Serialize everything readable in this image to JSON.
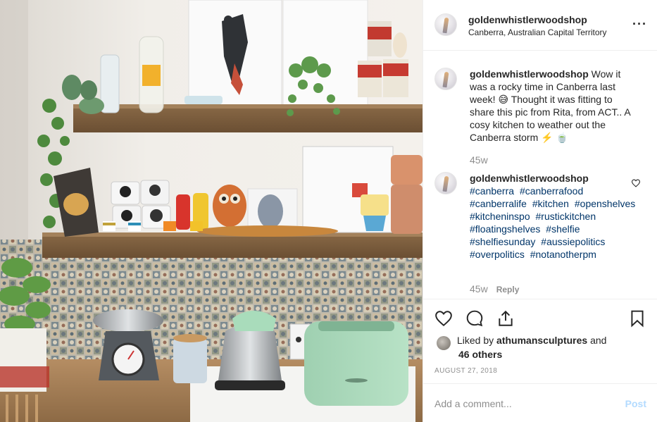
{
  "post": {
    "username": "goldenwhistlerwoodshop",
    "location": "Canberra, Australian Capital Territory",
    "more_icon": "more-horizontal-icon"
  },
  "caption": {
    "username": "goldenwhistlerwoodshop",
    "text": "Wow it was a rocky time in Canberra last week! 😅 Thought it was fitting to share this pic from Rita, from ACT.. A cosy kitchen to weather out the Canberra storm ⚡️ 🍵",
    "age": "45w"
  },
  "reply_comment": {
    "username": "goldenwhistlerwoodshop",
    "hashtags": [
      "#canberra",
      "#canberrafood",
      "#canberralife",
      "#kitchen",
      "#openshelves",
      "#kitcheninspo",
      "#rustickitchen",
      "#floatingshelves",
      "#shelfie",
      "#shelfiesunday",
      "#aussiepolitics",
      "#overpolitics",
      "#notanotherpm"
    ],
    "age": "45w",
    "reply_label": "Reply"
  },
  "actions": {
    "icons": [
      "heart-icon",
      "comment-icon",
      "share-icon",
      "bookmark-icon"
    ]
  },
  "likes": {
    "prefix": "Liked by",
    "liker": "athumansculptures",
    "conjunction": "and",
    "others": "46 others"
  },
  "date": "AUGUST 27, 2018",
  "comment_box": {
    "placeholder": "Add a comment...",
    "post_label": "Post",
    "post_color": "#b3dbff"
  },
  "colors": {
    "link": "#003569",
    "muted": "#8e8e8e",
    "text": "#262626",
    "divider": "#efefef"
  }
}
